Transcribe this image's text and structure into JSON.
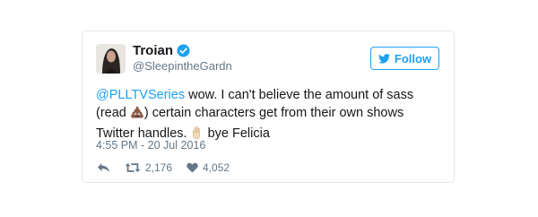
{
  "tweet": {
    "author_name": "Troian",
    "author_handle": "@SleepintheGardn",
    "follow_label": "Follow",
    "mention": "@PLLTVSeries",
    "text_part1": " wow. I can't believe the amount of sass (read ",
    "text_part2": ") certain characters get from their own shows Twitter handles. ",
    "text_part3": " bye Felicia",
    "emoji_1": "pile-of-poo",
    "emoji_2": "raised-hand",
    "timestamp": "4:55 PM - 20 Jul 2016",
    "retweet_count": "2,176",
    "like_count": "4,052"
  },
  "colors": {
    "accent": "#1da1f2",
    "muted": "#657786",
    "text": "#14171a",
    "border": "#e1e8ed"
  },
  "icons": [
    "reply-icon",
    "retweet-icon",
    "heart-icon",
    "verified-badge-icon",
    "twitter-bird-icon"
  ]
}
